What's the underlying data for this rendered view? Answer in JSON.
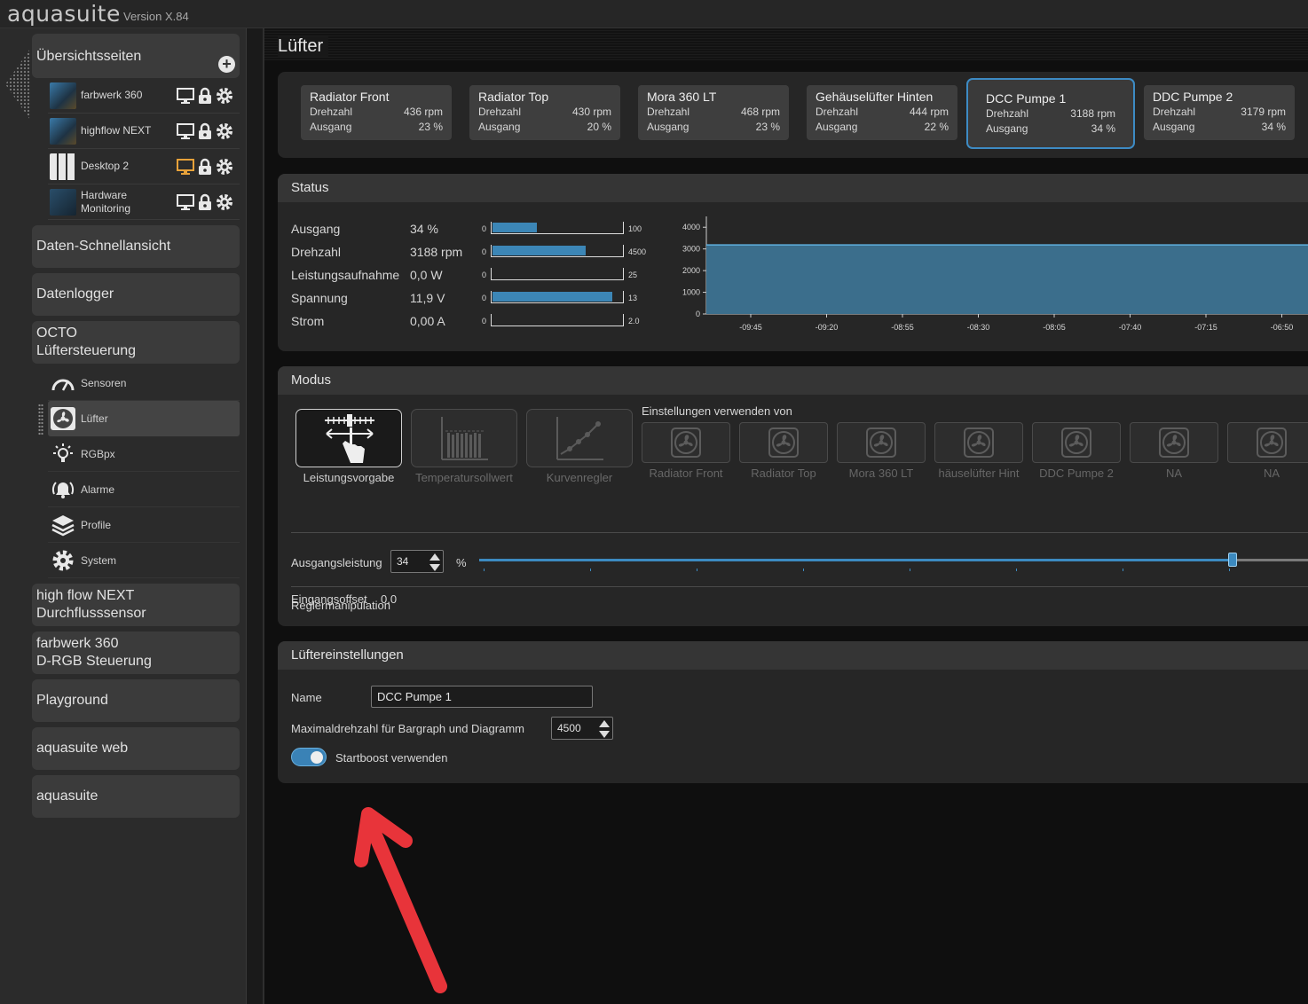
{
  "app": {
    "logo": "aquasuite",
    "version": "Version X.84"
  },
  "sidebar": {
    "overview": {
      "label": "Übersichtsseiten"
    },
    "pages": [
      {
        "name": "farbwerk 360",
        "display_color": "#e8e8e8"
      },
      {
        "name": "highflow NEXT",
        "display_color": "#e8e8e8"
      },
      {
        "name": "Desktop 2",
        "display_color": "#e8a23a"
      },
      {
        "name": "Hardware\nMonitoring",
        "display_color": "#e8e8e8"
      }
    ],
    "sections": [
      {
        "label": "Daten-Schnellansicht"
      },
      {
        "label": "Datenlogger"
      },
      {
        "label": "OCTO\nLüftersteuerung"
      }
    ],
    "octo_items": [
      {
        "label": "Sensoren",
        "icon": "gauge-icon"
      },
      {
        "label": "Lüfter",
        "icon": "fan-icon"
      },
      {
        "label": "RGBpx",
        "icon": "bulb-icon"
      },
      {
        "label": "Alarme",
        "icon": "alarm-icon"
      },
      {
        "label": "Profile",
        "icon": "layers-icon"
      },
      {
        "label": "System",
        "icon": "gear-icon"
      }
    ],
    "devices": [
      {
        "label": "high flow NEXT\nDurchflusssensor"
      },
      {
        "label": "farbwerk 360\nD-RGB Steuerung"
      },
      {
        "label": "Playground"
      },
      {
        "label": "aquasuite web"
      },
      {
        "label": "aquasuite"
      }
    ]
  },
  "page": {
    "title": "Lüfter"
  },
  "fans": [
    {
      "name": "Radiator Front",
      "speed_label": "Drehzahl",
      "speed": "436 rpm",
      "output_label": "Ausgang",
      "output": "23 %"
    },
    {
      "name": "Radiator Top",
      "speed_label": "Drehzahl",
      "speed": "430 rpm",
      "output_label": "Ausgang",
      "output": "20 %"
    },
    {
      "name": "Mora 360 LT",
      "speed_label": "Drehzahl",
      "speed": "468 rpm",
      "output_label": "Ausgang",
      "output": "23 %"
    },
    {
      "name": "Gehäuselüfter Hinten",
      "speed_label": "Drehzahl",
      "speed": "444 rpm",
      "output_label": "Ausgang",
      "output": "22 %"
    },
    {
      "name": "DCC Pumpe 1",
      "speed_label": "Drehzahl",
      "speed": "3188 rpm",
      "output_label": "Ausgang",
      "output": "34 %"
    },
    {
      "name": "DDC Pumpe 2",
      "speed_label": "Drehzahl",
      "speed": "3179 rpm",
      "output_label": "Ausgang",
      "output": "34 %"
    }
  ],
  "status": {
    "title": "Status",
    "rows": [
      {
        "name": "Ausgang",
        "value": "34 %",
        "min": "0",
        "max": "100",
        "fill": 0.34
      },
      {
        "name": "Drehzahl",
        "value": "3188 rpm",
        "min": "0",
        "max": "4500",
        "fill": 0.708
      },
      {
        "name": "Leistungsaufnahme",
        "value": "0,0 W",
        "min": "0",
        "max": "25",
        "fill": 0.0
      },
      {
        "name": "Spannung",
        "value": "11,9 V",
        "min": "0",
        "max": "13",
        "fill": 0.915
      },
      {
        "name": "Strom",
        "value": "0,00 A",
        "min": "0",
        "max": "2.0",
        "fill": 0.0
      }
    ]
  },
  "chart_data": {
    "type": "area",
    "x": [
      "-09:45",
      "-09:20",
      "-08:55",
      "-08:30",
      "-08:05",
      "-07:40",
      "-07:15",
      "-06:50"
    ],
    "yticks": [
      "0",
      "1000",
      "2000",
      "3000",
      "4000"
    ],
    "ylim": [
      0,
      4500
    ],
    "series": [
      {
        "values": [
          3188,
          3188,
          3188,
          3188,
          3188,
          3188,
          3188,
          3188
        ]
      }
    ],
    "color": "#3b6e8c",
    "line_color": "#5fb1de"
  },
  "modus": {
    "title": "Modus",
    "modes": [
      {
        "label": "Leistungsvorgabe",
        "active": true
      },
      {
        "label": "Temperatursollwert",
        "active": false
      },
      {
        "label": "Kurvenregler",
        "active": false
      }
    ],
    "source_title": "Einstellungen verwenden von",
    "sources": [
      "Radiator Front",
      "Radiator Top",
      "Mora 360 LT",
      "häuselüfter Hint",
      "DDC Pumpe 2",
      "NA",
      "NA"
    ],
    "output_label": "Ausgangsleistung",
    "output_value": "34",
    "output_unit": "%",
    "slider_fraction": 0.9,
    "manip_label": "Reglermanipulation",
    "offset_label": "Eingangsoffset",
    "offset_value": "0,0"
  },
  "settings": {
    "title": "Lüftereinstellungen",
    "name_label": "Name",
    "name_value": "DCC Pumpe 1",
    "max_label": "Maximaldrehzahl für Bargraph und Diagramm",
    "max_value": "4500",
    "boost_label": "Startboost verwenden",
    "boost_on": true
  }
}
